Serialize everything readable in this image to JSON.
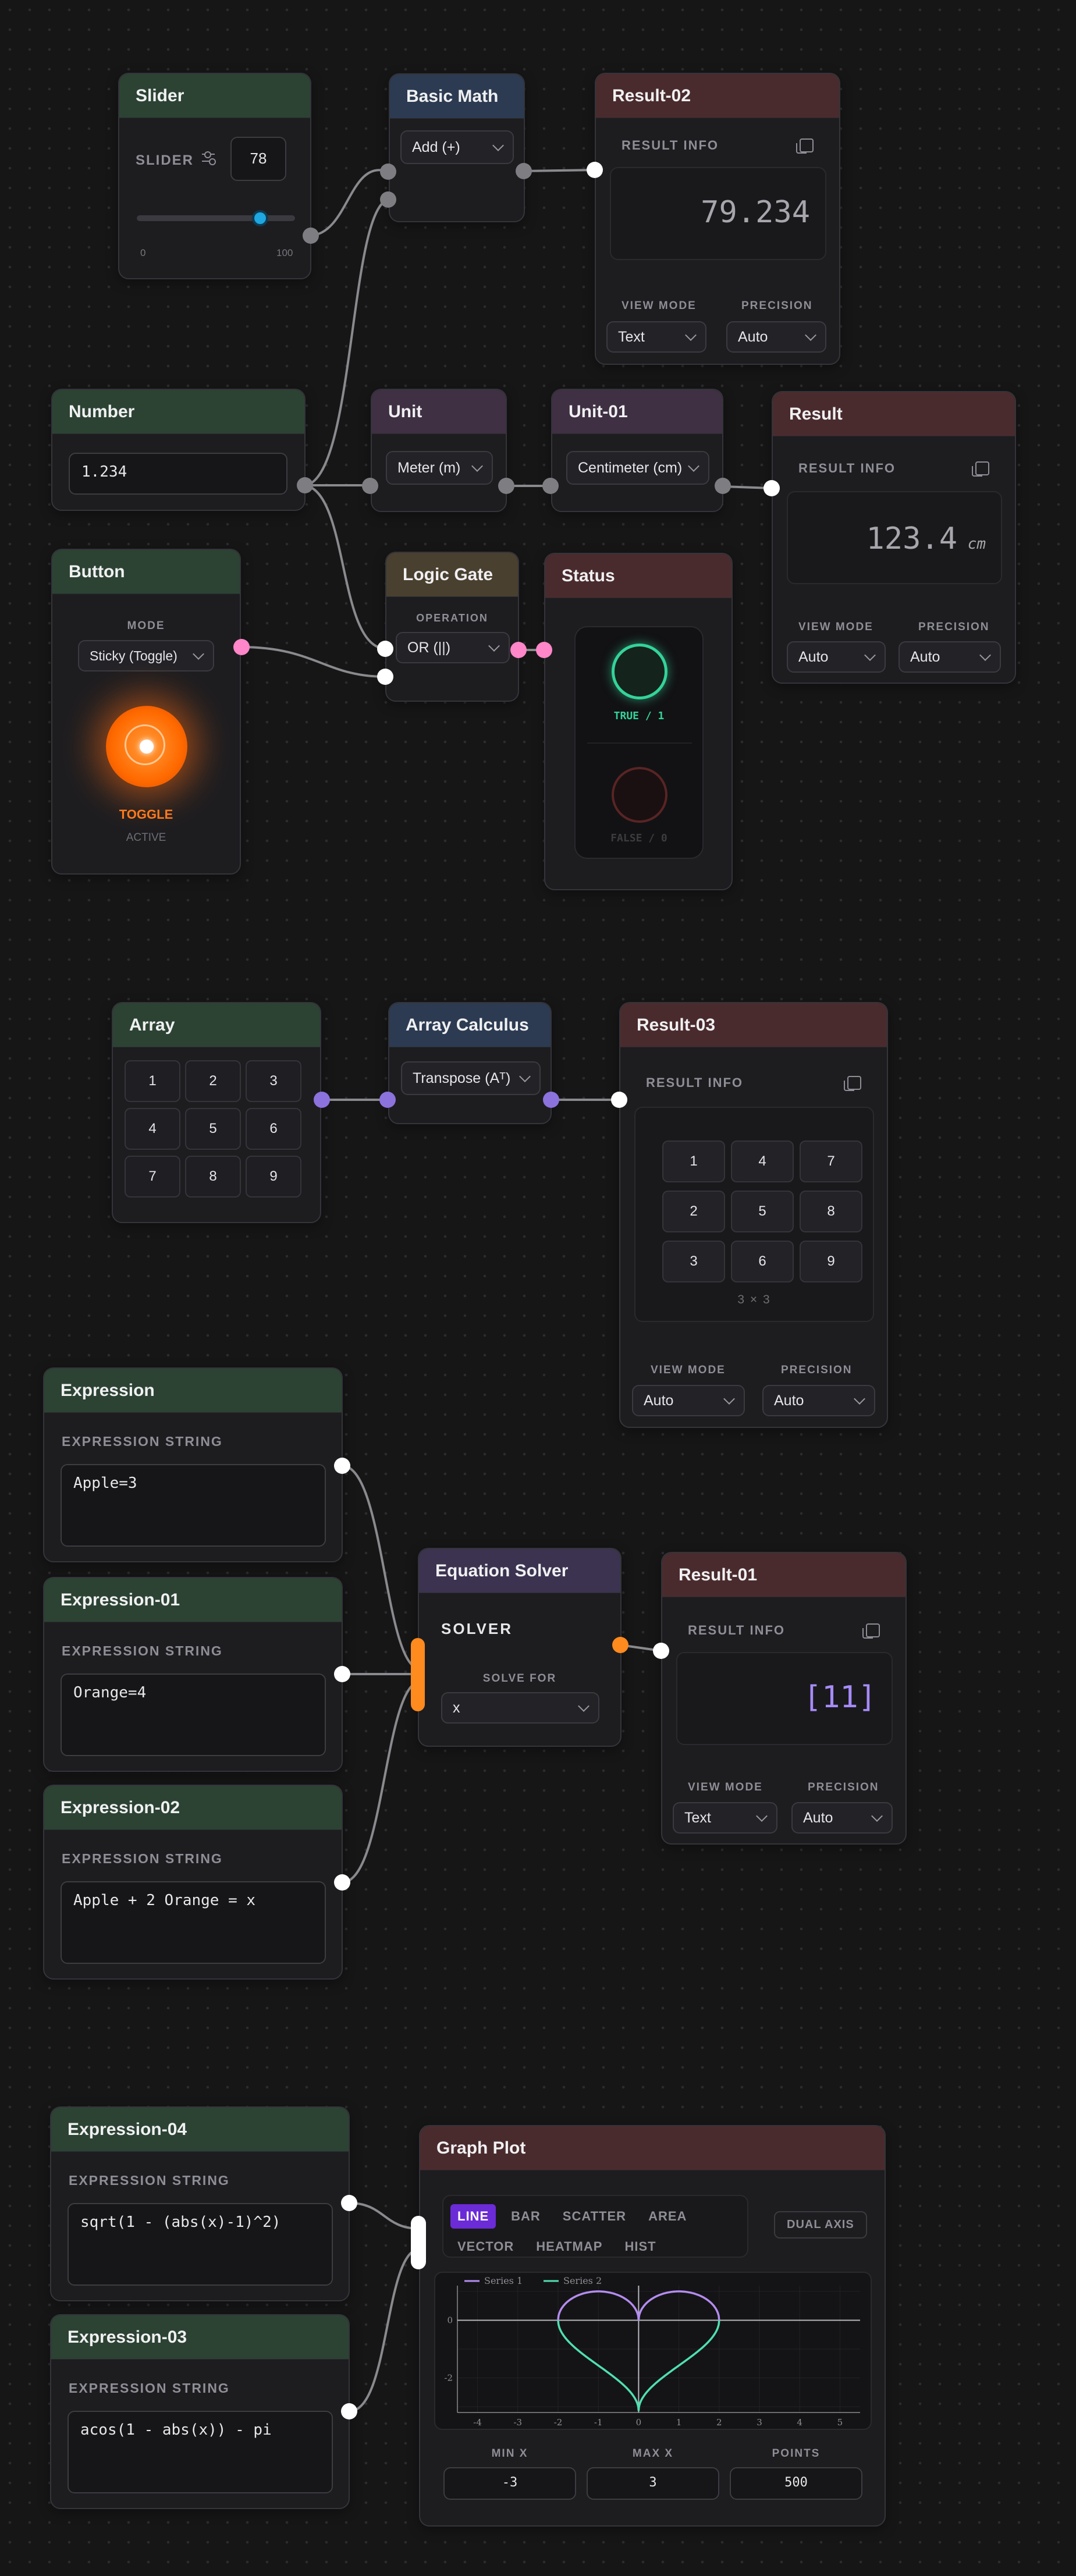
{
  "slider": {
    "title": "Slider",
    "label": "SLIDER",
    "value": "78",
    "min_label": "0",
    "max_label": "100",
    "fraction": 0.78
  },
  "basic_math": {
    "title": "Basic Math",
    "operation": "Add (+)"
  },
  "result02": {
    "title": "Result-02",
    "info": "RESULT INFO",
    "value": "79.234",
    "view_mode_label": "VIEW MODE",
    "view_mode": "Text",
    "precision_label": "PRECISION",
    "precision": "Auto"
  },
  "number": {
    "title": "Number",
    "value": "1.234"
  },
  "unit": {
    "title": "Unit",
    "value": "Meter (m)"
  },
  "unit01": {
    "title": "Unit-01",
    "value": "Centimeter (cm)"
  },
  "result": {
    "title": "Result",
    "info": "RESULT INFO",
    "value": "123.4",
    "unit": "cm",
    "view_mode_label": "VIEW MODE",
    "view_mode": "Auto",
    "precision_label": "PRECISION",
    "precision": "Auto"
  },
  "button": {
    "title": "Button",
    "mode_label": "MODE",
    "mode": "Sticky (Toggle)",
    "state": "TOGGLE",
    "sub": "ACTIVE"
  },
  "logic_gate": {
    "title": "Logic Gate",
    "op_label": "OPERATION",
    "operation": "OR (||)"
  },
  "status": {
    "title": "Status",
    "true_label": "TRUE / 1",
    "false_label": "FALSE / 0"
  },
  "array": {
    "title": "Array",
    "cells": [
      "1",
      "2",
      "3",
      "4",
      "5",
      "6",
      "7",
      "8",
      "9"
    ]
  },
  "array_calc": {
    "title": "Array Calculus",
    "operation": "Transpose (Aᵀ)"
  },
  "result03": {
    "title": "Result-03",
    "info": "RESULT INFO",
    "cells": [
      "1",
      "4",
      "7",
      "2",
      "5",
      "8",
      "3",
      "6",
      "9"
    ],
    "dims": "3 × 3",
    "view_mode_label": "VIEW MODE",
    "view_mode": "Auto",
    "precision_label": "PRECISION",
    "precision": "Auto"
  },
  "expression": {
    "title": "Expression",
    "label": "EXPRESSION STRING",
    "value": "Apple=3"
  },
  "expression01": {
    "title": "Expression-01",
    "label": "EXPRESSION STRING",
    "value": "Orange=4"
  },
  "expression02": {
    "title": "Expression-02",
    "label": "EXPRESSION STRING",
    "value": "Apple + 2 Orange = x"
  },
  "solver": {
    "title": "Equation Solver",
    "heading": "SOLVER",
    "solve_for_label": "SOLVE FOR",
    "solve_for": "x"
  },
  "result01": {
    "title": "Result-01",
    "info": "RESULT INFO",
    "value": "[11]",
    "view_mode_label": "VIEW MODE",
    "view_mode": "Text",
    "precision_label": "PRECISION",
    "precision": "Auto"
  },
  "expression04": {
    "title": "Expression-04",
    "label": "EXPRESSION STRING",
    "value": "sqrt(1 - (abs(x)-1)^2)"
  },
  "expression03": {
    "title": "Expression-03",
    "label": "EXPRESSION STRING",
    "value": "acos(1 - abs(x)) - pi"
  },
  "graph": {
    "title": "Graph Plot",
    "tabs": [
      "LINE",
      "BAR",
      "SCATTER",
      "AREA",
      "VECTOR",
      "HEATMAP",
      "HIST"
    ],
    "active_tab": "LINE",
    "dual_axis": "DUAL AXIS",
    "min_x_label": "MIN X",
    "min_x": "-3",
    "max_x_label": "MAX X",
    "max_x": "3",
    "points_label": "POINTS",
    "points": "500"
  },
  "chart_data": {
    "type": "line",
    "series": [
      {
        "name": "Series 1",
        "color": "#b48cf0",
        "expr": "sqrt(1 - (abs(x)-1)^2)"
      },
      {
        "name": "Series 2",
        "color": "#4fe0b0",
        "expr": "acos(1 - abs(x)) - pi"
      }
    ],
    "xlim": [
      -4.5,
      5.5
    ],
    "ylim": [
      -3.2,
      1.2
    ],
    "xticks": [
      "-4",
      "-3",
      "-2",
      "-1",
      "0",
      "1",
      "2",
      "3",
      "4",
      "5"
    ],
    "yticks": [
      "0",
      "-2"
    ],
    "grid": true,
    "legend": "top-left"
  },
  "colors": {
    "white_port": "#ffffff",
    "gray_port": "#7d7d82",
    "pink_port": "#ff86c8",
    "violet_port": "#8c72dc",
    "orange_port": "#ff8a1e",
    "wire": "#8a8a8e",
    "true_ring": "#34d399",
    "false_ring": "#7a2b2b"
  }
}
